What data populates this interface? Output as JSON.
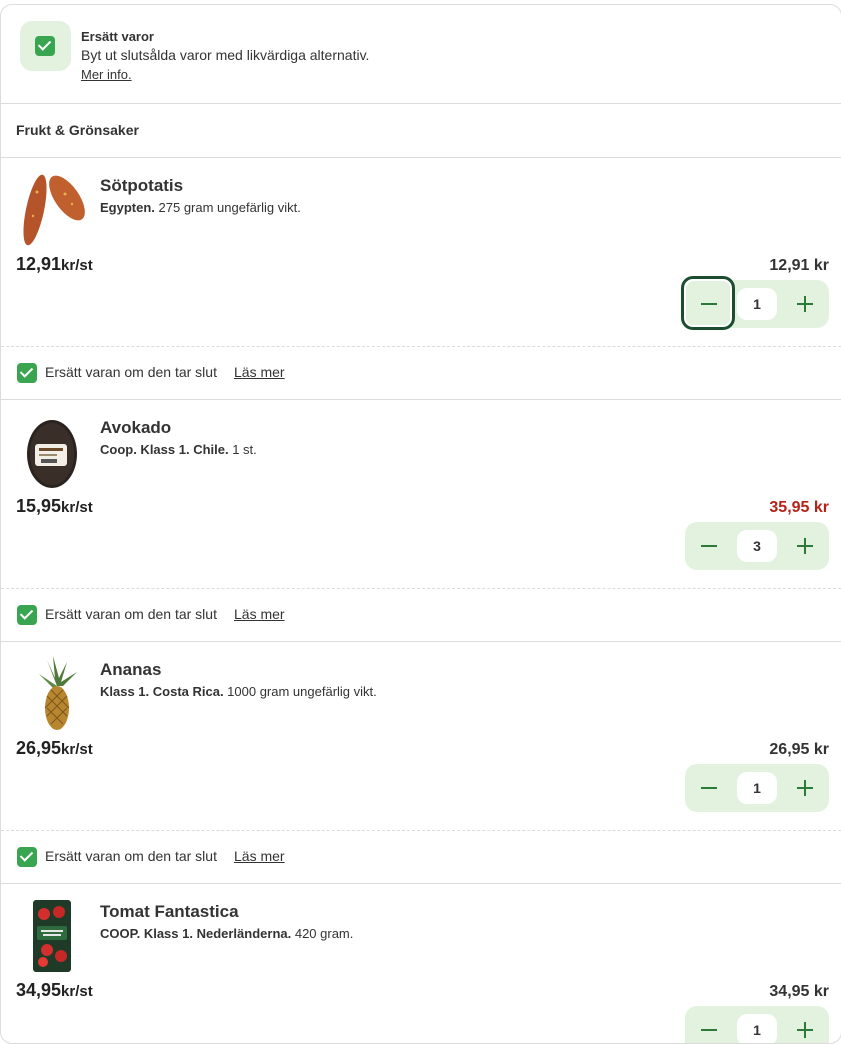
{
  "replace_banner": {
    "title": "Ersätt varor",
    "description": "Byt ut slutsålda varor med likvärdiga alternativ.",
    "more_link": "Mer info."
  },
  "category": "Frukt & Grönsaker",
  "products": [
    {
      "name": "Sötpotatis",
      "origin": "Egypten.",
      "detail": " 275 gram ungefärlig vikt.",
      "unit_price": "12,91",
      "unit": "kr/st",
      "total": "12,91 kr",
      "quantity": "1",
      "replace_label": "Ersätt varan om den tar slut",
      "replace_link": "Läs mer"
    },
    {
      "name": "Avokado",
      "origin": "Coop. Klass 1. Chile.",
      "detail": " 1 st.",
      "unit_price": "15,95",
      "unit": "kr/st",
      "total": "35,95 kr",
      "quantity": "3",
      "replace_label": "Ersätt varan om den tar slut",
      "replace_link": "Läs mer"
    },
    {
      "name": "Ananas",
      "origin": "Klass 1. Costa Rica.",
      "detail": " 1000 gram ungefärlig vikt.",
      "unit_price": "26,95",
      "unit": "kr/st",
      "total": "26,95 kr",
      "quantity": "1",
      "replace_label": "Ersätt varan om den tar slut",
      "replace_link": "Läs mer"
    },
    {
      "name": "Tomat Fantastica",
      "origin": "COOP. Klass 1. Nederländerna.",
      "detail": " 420 gram.",
      "unit_price": "34,95",
      "unit": "kr/st",
      "total": "34,95 kr",
      "quantity": "1"
    }
  ],
  "colors": {
    "accent_green": "#39a550",
    "stepper_bg": "#e3f2df",
    "discount_red": "#b42318"
  }
}
